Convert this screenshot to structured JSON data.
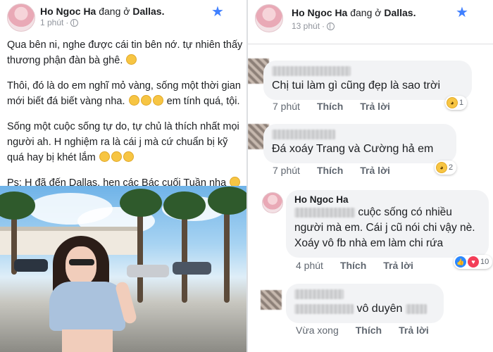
{
  "post": {
    "author": "Ho Ngoc Ha",
    "status_verb": "đang ở",
    "location": "Dallas.",
    "time": "1 phút",
    "paragraphs": [
      "Qua bên ni, nghe được cái tin bên nớ. tự nhiên thấy thương phận đàn bà ghê.",
      "Thôi, đó là do em nghĩ mỏ vàng, sống một thời gian mới biết đá biết vàng nha.",
      "em tính quá, tội.",
      "Sống một cuộc sống tự do, tự chủ là thích nhất mọi người ah. H nghiệm ra là cái j mà cứ chuẩn bị kỹ quá hay bị khét lắm",
      "Ps: H đã đến Dallas, hẹn các Bác cuối Tuần nha"
    ]
  },
  "comments_header": {
    "author": "Ho Ngoc Ha",
    "status_verb": "đang ở",
    "location": "Dallas.",
    "time": "13 phút"
  },
  "comments": [
    {
      "text": "Chị tui làm gì cũng đẹp là sao trời",
      "time": "7 phút",
      "like": "Thích",
      "reply": "Trả lời",
      "reaction_count": "1"
    },
    {
      "text": "Đá xoáy Trang và  Cường hả em",
      "time": "7 phút",
      "like": "Thích",
      "reply": "Trả lời",
      "reaction_count": "2"
    },
    {
      "author": "Ho Ngoc Ha",
      "text": "cuộc sống có nhiều người mà em. Cái j cũ nói chi vậy nè. Xoáy vô fb nhà em làm chi rứa",
      "time": "4 phút",
      "like": "Thích",
      "reply": "Trả lời",
      "reaction_count": "10"
    },
    {
      "text": "vô duyên",
      "time": "Vừa xong",
      "like": "Thích",
      "reply": "Trả lời"
    }
  ],
  "icons": {
    "star": "star-icon",
    "globe": "globe-icon",
    "haha": "haha-reaction-icon",
    "like": "like-reaction-icon",
    "love": "love-reaction-icon"
  },
  "colors": {
    "accent": "#4080ff",
    "bubble": "#f2f3f5",
    "meta": "#90949c"
  }
}
